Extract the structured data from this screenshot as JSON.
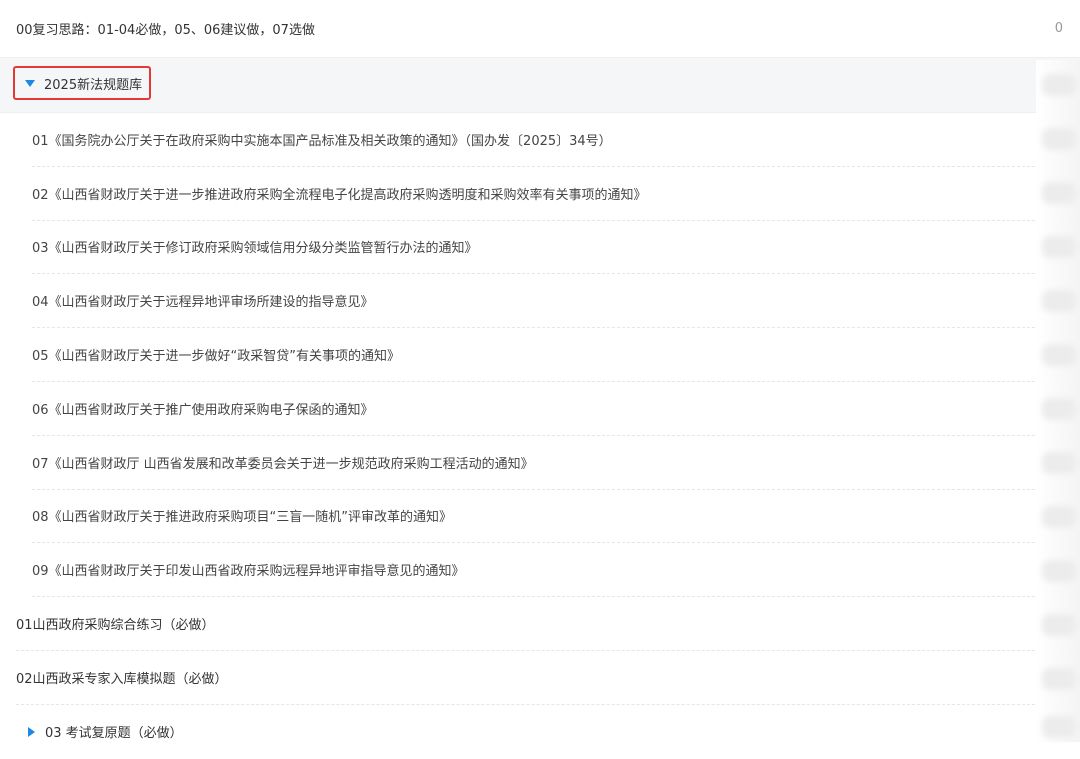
{
  "top_item": {
    "label": "00复习思路：01-04必做，05、06建议做，07选做",
    "count": "0"
  },
  "category": {
    "label": "2025新法规题库",
    "expanded": true
  },
  "sub_items": [
    {
      "label": "01《国务院办公厅关于在政府采购中实施本国产品标准及相关政策的通知》（国办发〔2025〕34号）"
    },
    {
      "label": "02《山西省财政厅关于进一步推进政府采购全流程电子化提高政府采购透明度和采购效率有关事项的通知》"
    },
    {
      "label": "03《山西省财政厅关于修订政府采购领域信用分级分类监管暂行办法的通知》"
    },
    {
      "label": "04《山西省财政厅关于远程异地评审场所建设的指导意见》"
    },
    {
      "label": "05《山西省财政厅关于进一步做好“政采智贷”有关事项的通知》"
    },
    {
      "label": "06《山西省财政厅关于推广使用政府采购电子保函的通知》"
    },
    {
      "label": "07《山西省财政厅 山西省发展和改革委员会关于进一步规范政府采购工程活动的通知》"
    },
    {
      "label": "08《山西省财政厅关于推进政府采购项目“三盲一随机”评审改革的通知》"
    },
    {
      "label": "09《山西省财政厅关于印发山西省政府采购远程异地评审指导意见的通知》"
    }
  ],
  "main_items": [
    {
      "label": "01山西政府采购综合练习（必做）"
    },
    {
      "label": "02山西政采专家入库模拟题（必做）"
    }
  ],
  "folder_item": {
    "label": "03 考试复原题（必做）",
    "expanded": false
  },
  "colors": {
    "accent": "#1e88e5",
    "highlight_border": "#e53935",
    "text": "#333333"
  }
}
